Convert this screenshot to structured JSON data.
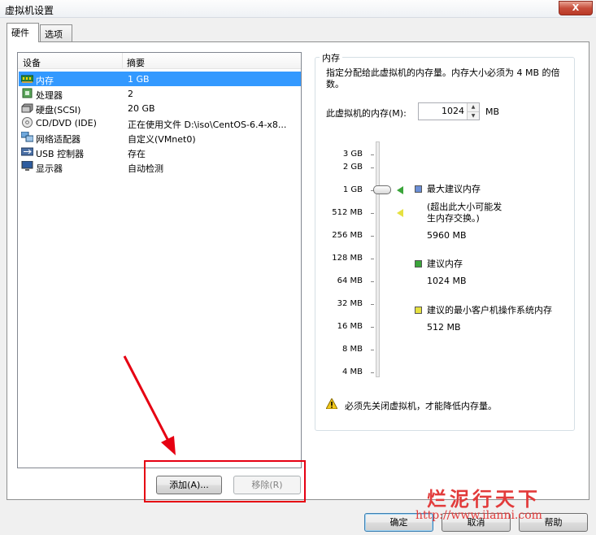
{
  "window": {
    "title": "虚拟机设置",
    "close_label": "X"
  },
  "tabs": [
    {
      "label": "硬件",
      "active": true
    },
    {
      "label": "选项",
      "active": false
    }
  ],
  "devices": {
    "headers": {
      "device": "设备",
      "summary": "摘要"
    },
    "rows": [
      {
        "name": "内存",
        "summary": "1 GB",
        "icon": "memory-icon",
        "selected": true
      },
      {
        "name": "处理器",
        "summary": "2",
        "icon": "processor-icon"
      },
      {
        "name": "硬盘(SCSI)",
        "summary": "20 GB",
        "icon": "harddisk-icon"
      },
      {
        "name": "CD/DVD (IDE)",
        "summary": "正在使用文件 D:\\iso\\CentOS-6.4-x8...",
        "icon": "cdrom-icon"
      },
      {
        "name": "网络适配器",
        "summary": "自定义(VMnet0)",
        "icon": "network-adapter-icon"
      },
      {
        "name": "USB 控制器",
        "summary": "存在",
        "icon": "usb-icon"
      },
      {
        "name": "显示器",
        "summary": "自动检测",
        "icon": "monitor-icon"
      }
    ]
  },
  "buttons": {
    "add": "添加(A)...",
    "remove": "移除(R)",
    "ok": "确定",
    "cancel": "取消",
    "help": "帮助"
  },
  "memory": {
    "group_title": "内存",
    "description": "指定分配给此虚拟机的内存量。内存大小必须为 4 MB 的倍数。",
    "field_label": "此虚拟机的内存(M):",
    "value": "1024",
    "unit": "MB",
    "scale": [
      "3 GB",
      "2 GB",
      "1 GB",
      "512 MB",
      "256 MB",
      "128 MB",
      "64 MB",
      "32 MB",
      "16 MB",
      "8 MB",
      "4 MB"
    ],
    "legend": {
      "max_title": "最大建议内存",
      "max_note": "(超出此大小可能发生内存交换。)",
      "max_value": "5960 MB",
      "rec_title": "建议内存",
      "rec_value": "1024 MB",
      "min_title": "建议的最小客户机操作系统内存",
      "min_value": "512 MB"
    },
    "warning": "必须先关闭虚拟机，才能降低内存量。"
  },
  "watermark": {
    "line1": "烂泥行天下",
    "line2": "http://www.ilanni.com"
  },
  "colors": {
    "selection": "#3399ff",
    "annotation": "#e60012",
    "max_marker": "#6b8fd6",
    "rec_marker": "#3aa53a",
    "min_marker": "#e6e140"
  }
}
